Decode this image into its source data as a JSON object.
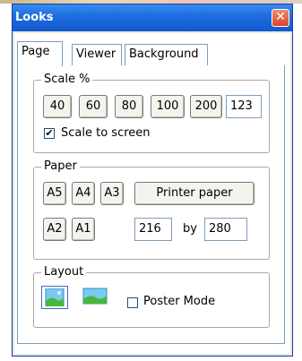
{
  "window": {
    "title": "Looks",
    "close_glyph": "✕"
  },
  "tabs": [
    {
      "label": "Page"
    },
    {
      "label": "Viewer"
    },
    {
      "label": "Background"
    }
  ],
  "scale": {
    "legend": "Scale %",
    "buttons": [
      "40",
      "60",
      "80",
      "100",
      "200"
    ],
    "value": "123",
    "scale_to_screen_label": "Scale to screen",
    "scale_to_screen_checked": true
  },
  "paper": {
    "legend": "Paper",
    "sizes_row1": [
      "A5",
      "A4",
      "A3"
    ],
    "sizes_row2": [
      "A2",
      "A1"
    ],
    "printer_paper_label": "Printer paper",
    "width": "216",
    "by_label": "by",
    "height": "280"
  },
  "layout": {
    "legend": "Layout",
    "portrait_icon": "portrait-landscape-image-icon",
    "landscape_icon": "landscape-image-icon",
    "poster_mode_label": "Poster Mode",
    "poster_mode_checked": false
  }
}
